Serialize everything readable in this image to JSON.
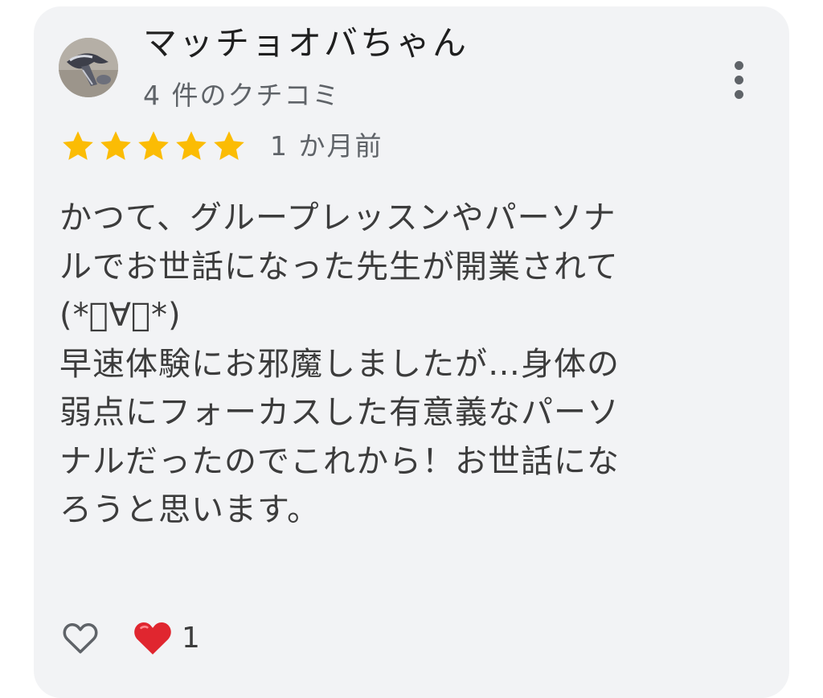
{
  "review": {
    "author_name": "マッチョオバちゃん",
    "author_review_count": "4 件のクチコミ",
    "rating": 5,
    "max_rating": 5,
    "time_ago": "1 か月前",
    "body_lines": [
      "かつて、グループレッスンやパーソナ",
      "ルでお世話になった先生が開業されて",
      "(*ﾟ∀ﾟ*)",
      "早速体験にお邪魔しましたが…身体の",
      "弱点にフォーカスした有意義なパーソ",
      "ナルだったのでこれから！お世話にな",
      "ろうと思います。"
    ]
  },
  "actions": {
    "like_icon": "heart-outline-icon",
    "reaction_icon": "red-heart-icon",
    "reaction_count": "1"
  },
  "menu": {
    "icon": "more-vertical-icon"
  },
  "colors": {
    "card_background": "#f2f3f5",
    "star_color": "#fbbc04",
    "heart_color": "#e0262f",
    "primary_text": "#1f1f1f",
    "secondary_text": "#5f6368"
  }
}
